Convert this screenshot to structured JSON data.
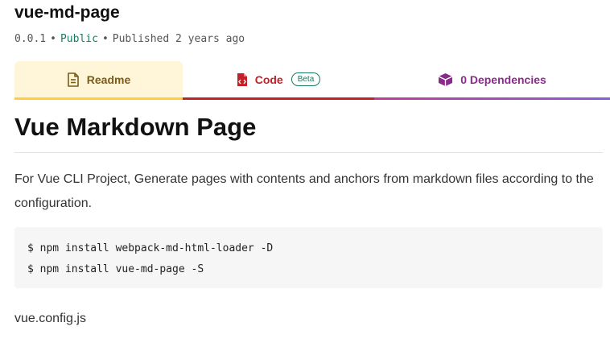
{
  "package": {
    "name": "vue-md-page",
    "version": "0.0.1",
    "visibility": "Public",
    "published": "Published 2 years ago",
    "separator": "•"
  },
  "tabs": {
    "readme": {
      "label": "Readme",
      "icon": "file-text-icon"
    },
    "code": {
      "label": "Code",
      "icon": "code-file-icon",
      "badge": "Beta"
    },
    "dependencies": {
      "label": "0 Dependencies",
      "icon": "box-icon"
    }
  },
  "readme": {
    "heading": "Vue Markdown Page",
    "paragraph": "For Vue CLI Project, Generate pages with contents and anchors from markdown files according to the configuration.",
    "code_lines": [
      "$ npm install webpack-md-html-loader -D",
      "$ npm install vue-md-page -S"
    ],
    "filename": "vue.config.js"
  },
  "colors": {
    "readme_accent": "#ffcd3a",
    "code_accent": "#c12127",
    "deps_accent": "#8a2b8c",
    "public_green": "#1a7a61"
  }
}
